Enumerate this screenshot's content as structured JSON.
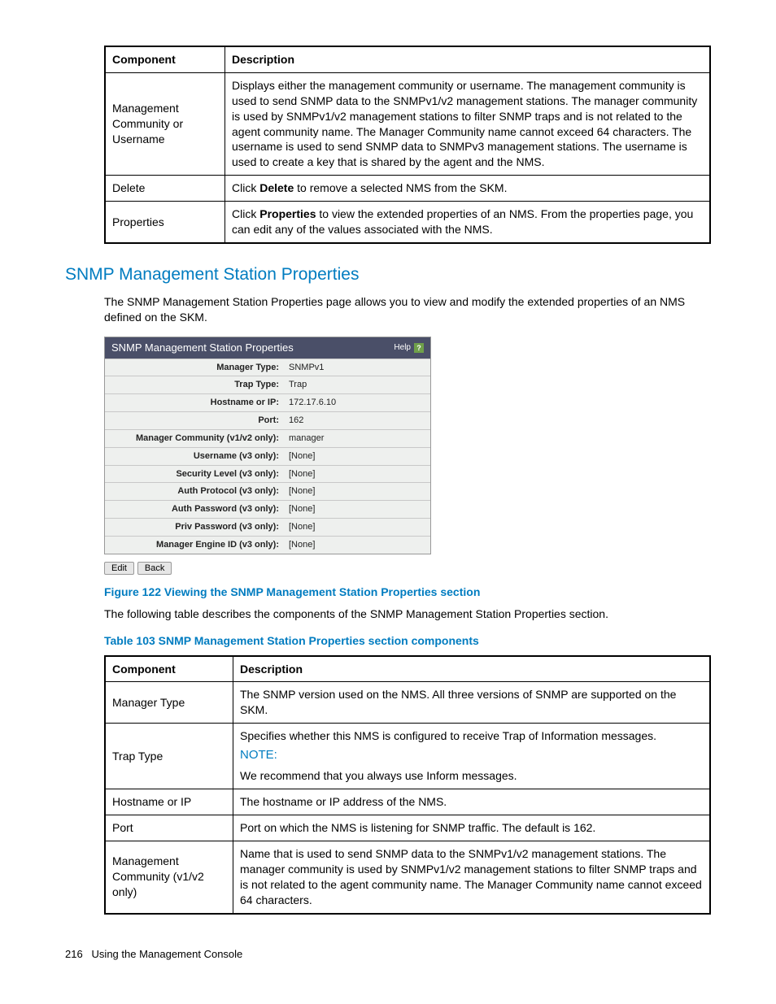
{
  "table1": {
    "headers": [
      "Component",
      "Description"
    ],
    "rows": [
      {
        "c": "Management Community or Username",
        "d": "Displays either the management community or username. The management community is used to send SNMP data to the SNMPv1/v2 management stations. The manager community is used by SNMPv1/v2 management stations to filter SNMP traps and is not related to the agent community name. The Manager Community name cannot exceed 64 characters. The username is used to send SNMP data to SNMPv3 management stations. The username is used to create a key that is shared by the agent and the NMS."
      },
      {
        "c": "Delete",
        "d_pre": "Click ",
        "d_bold": "Delete",
        "d_post": " to remove a selected NMS from the SKM."
      },
      {
        "c": "Properties",
        "d_pre": "Click ",
        "d_bold": "Properties",
        "d_post": " to view the extended properties of an NMS. From the properties page, you can edit any of the values associated with the NMS."
      }
    ]
  },
  "section_heading": "SNMP Management Station Properties",
  "intro_para": "The SNMP Management Station Properties page allows you to view and modify the extended properties of an NMS defined on the SKM.",
  "panel": {
    "title": "SNMP Management Station Properties",
    "help": "Help",
    "rows": [
      {
        "k": "Manager Type:",
        "v": "SNMPv1"
      },
      {
        "k": "Trap Type:",
        "v": "Trap"
      },
      {
        "k": "Hostname or IP:",
        "v": "172.17.6.10"
      },
      {
        "k": "Port:",
        "v": "162"
      },
      {
        "k": "Manager Community (v1/v2 only):",
        "v": "manager"
      },
      {
        "k": "Username (v3 only):",
        "v": "[None]"
      },
      {
        "k": "Security Level (v3 only):",
        "v": "[None]"
      },
      {
        "k": "Auth Protocol (v3 only):",
        "v": "[None]"
      },
      {
        "k": "Auth Password (v3 only):",
        "v": "[None]"
      },
      {
        "k": "Priv Password (v3 only):",
        "v": "[None]"
      },
      {
        "k": "Manager Engine ID (v3 only):",
        "v": "[None]"
      }
    ],
    "buttons": {
      "edit": "Edit",
      "back": "Back"
    }
  },
  "figure_caption": "Figure 122 Viewing the SNMP Management Station Properties section",
  "following_para": "The following table describes the components of the SNMP Management Station Properties section.",
  "table_caption": "Table 103 SNMP Management Station Properties section components",
  "table2": {
    "headers": [
      "Component",
      "Description"
    ],
    "rows": [
      {
        "c": "Manager Type",
        "d": "The SNMP version used on the NMS. All three versions of SNMP are supported on the SKM."
      },
      {
        "c": "Trap Type",
        "d_top": "Specifies whether this NMS is configured to receive Trap of Information messages.",
        "note": "NOTE:",
        "d_bottom": "We recommend that you always use Inform messages."
      },
      {
        "c": "Hostname or IP",
        "d": "The hostname or IP address of the NMS."
      },
      {
        "c": "Port",
        "d": "Port on which the NMS is listening for SNMP traffic. The default is 162."
      },
      {
        "c": "Management Community (v1/v2 only)",
        "d": "Name that is used to send SNMP data to the SNMPv1/v2 management stations. The manager community is used by SNMPv1/v2 management stations to filter SNMP traps and is not related to the agent community name. The Manager Community name cannot exceed 64 characters."
      }
    ]
  },
  "footer": {
    "page": "216",
    "title": "Using the Management Console"
  }
}
